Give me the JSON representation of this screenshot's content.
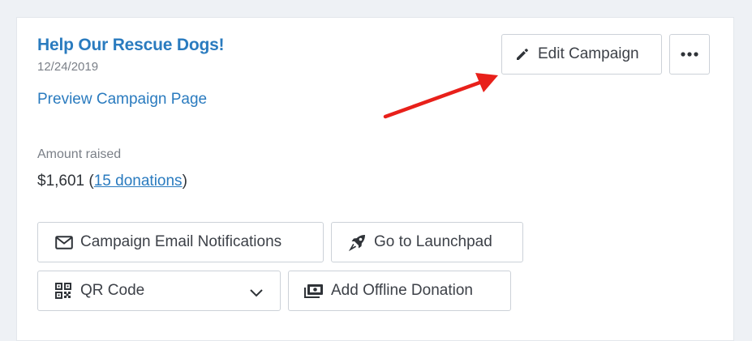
{
  "campaign": {
    "title": "Help Our Rescue Dogs!",
    "date": "12/24/2019",
    "preview_link": "Preview Campaign Page"
  },
  "actions": {
    "edit_label": "Edit Campaign",
    "more_icon": "more-horizontal-icon"
  },
  "stats": {
    "amount_label": "Amount raised",
    "amount_value": "$1,601",
    "open_paren": " (",
    "donations_link": "15 donations",
    "close_paren": ")"
  },
  "buttons": {
    "email_notifications": "Campaign Email Notifications",
    "launchpad": "Go to Launchpad",
    "qr_code": "QR Code",
    "offline_donation": "Add Offline Donation"
  },
  "colors": {
    "link_blue": "#2a7bbf",
    "annotation_arrow": "#e8201a"
  }
}
